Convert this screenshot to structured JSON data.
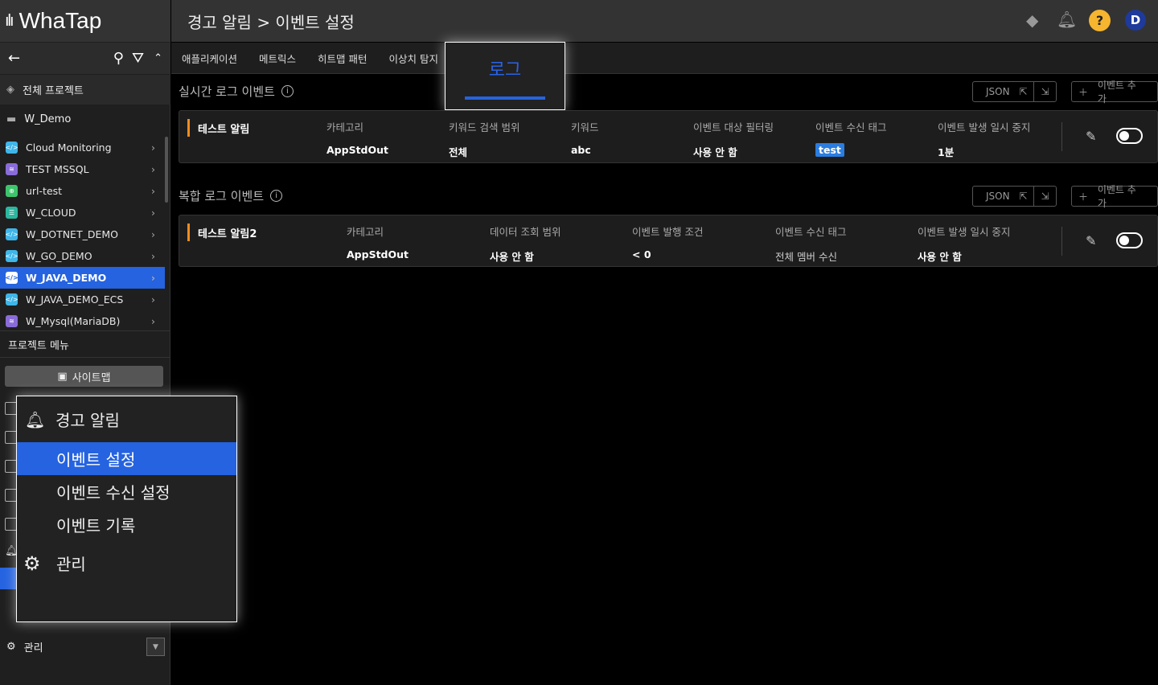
{
  "app": {
    "logo": "WhaTap"
  },
  "header": {
    "breadcrumb": "경고 알림 > 이벤트 설정"
  },
  "sidebar": {
    "all_projects": "전체 프로젝트",
    "group": "W_Demo",
    "projects": [
      {
        "name": "Cloud Monitoring",
        "icon": "code-icon",
        "color": "#3fb5e8"
      },
      {
        "name": "TEST MSSQL",
        "icon": "database-icon",
        "color": "#8a6cd8"
      },
      {
        "name": "url-test",
        "icon": "globe-icon",
        "color": "#3ec46d"
      },
      {
        "name": "W_CLOUD",
        "icon": "server-icon",
        "color": "#2bb7a0"
      },
      {
        "name": "W_DOTNET_DEMO",
        "icon": "code-icon",
        "color": "#3fb5e8"
      },
      {
        "name": "W_GO_DEMO",
        "icon": "code-icon",
        "color": "#3fb5e8"
      },
      {
        "name": "W_JAVA_DEMO",
        "icon": "code-icon",
        "color": "#3fb5e8",
        "selected": true
      },
      {
        "name": "W_JAVA_DEMO_ECS",
        "icon": "code-icon",
        "color": "#3fb5e8"
      },
      {
        "name": "W_Mysql(MariaDB)",
        "icon": "database-icon",
        "color": "#8a6cd8"
      }
    ],
    "project_menu": "프로젝트 메뉴",
    "sitemap": "사이트맵",
    "manage": "관리"
  },
  "tabs": [
    "애플리케이션",
    "메트릭스",
    "히트맵 패턴",
    "이상치 탐지",
    "로그"
  ],
  "active_tab": "로그",
  "realtime": {
    "title": "실시간 로그 이벤트",
    "json": "JSON",
    "add": "이벤트 추가",
    "name": "테스트 알림",
    "columns": [
      {
        "label": "카테고리",
        "value": "AppStdOut"
      },
      {
        "label": "키워드 검색 범위",
        "value": "전체"
      },
      {
        "label": "키워드",
        "value": "abc"
      },
      {
        "label": "이벤트 대상 필터링",
        "value": "사용 안 함"
      },
      {
        "label": "이벤트 수신 태그",
        "value": "test"
      },
      {
        "label": "이벤트 발생 일시 중지",
        "value": "1분"
      }
    ]
  },
  "composite": {
    "title": "복합 로그 이벤트",
    "json": "JSON",
    "add": "이벤트 추가",
    "name": "테스트 알림2",
    "columns": [
      {
        "label": "카테고리",
        "value": "AppStdOut"
      },
      {
        "label": "데이터 조회 범위",
        "value": "사용 안 함"
      },
      {
        "label": "이벤트 발행 조건",
        "value": "< 0"
      },
      {
        "label": "이벤트 수신 태그",
        "value": "전체 멤버 수신"
      },
      {
        "label": "이벤트 발생 일시 중지",
        "value": "사용 안 함"
      }
    ]
  },
  "popup": {
    "title": "경고 알림",
    "items": [
      "이벤트 설정",
      "이벤트 수신 설정",
      "이벤트 기록"
    ],
    "manage": "관리"
  },
  "user": {
    "initial": "D"
  }
}
